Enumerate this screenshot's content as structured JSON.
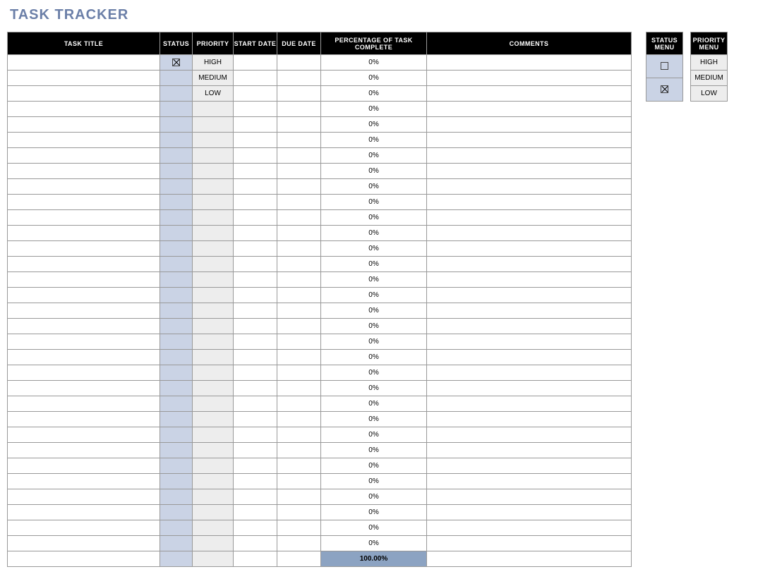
{
  "title": "TASK TRACKER",
  "headers": {
    "task_title": "TASK TITLE",
    "status": "STATUS",
    "priority": "PRIORITY",
    "start_date": "START DATE",
    "due_date": "DUE DATE",
    "pct_complete": "PERCENTAGE OF TASK COMPLETE",
    "comments": "COMMENTS"
  },
  "rows": [
    {
      "title": "",
      "status_checked": true,
      "priority": "HIGH",
      "start": "",
      "due": "",
      "pct": "0%",
      "comments": ""
    },
    {
      "title": "",
      "status_checked": false,
      "priority": "MEDIUM",
      "start": "",
      "due": "",
      "pct": "0%",
      "comments": ""
    },
    {
      "title": "",
      "status_checked": false,
      "priority": "LOW",
      "start": "",
      "due": "",
      "pct": "0%",
      "comments": ""
    },
    {
      "title": "",
      "status_checked": false,
      "priority": "",
      "start": "",
      "due": "",
      "pct": "0%",
      "comments": ""
    },
    {
      "title": "",
      "status_checked": false,
      "priority": "",
      "start": "",
      "due": "",
      "pct": "0%",
      "comments": ""
    },
    {
      "title": "",
      "status_checked": false,
      "priority": "",
      "start": "",
      "due": "",
      "pct": "0%",
      "comments": ""
    },
    {
      "title": "",
      "status_checked": false,
      "priority": "",
      "start": "",
      "due": "",
      "pct": "0%",
      "comments": ""
    },
    {
      "title": "",
      "status_checked": false,
      "priority": "",
      "start": "",
      "due": "",
      "pct": "0%",
      "comments": ""
    },
    {
      "title": "",
      "status_checked": false,
      "priority": "",
      "start": "",
      "due": "",
      "pct": "0%",
      "comments": ""
    },
    {
      "title": "",
      "status_checked": false,
      "priority": "",
      "start": "",
      "due": "",
      "pct": "0%",
      "comments": ""
    },
    {
      "title": "",
      "status_checked": false,
      "priority": "",
      "start": "",
      "due": "",
      "pct": "0%",
      "comments": ""
    },
    {
      "title": "",
      "status_checked": false,
      "priority": "",
      "start": "",
      "due": "",
      "pct": "0%",
      "comments": ""
    },
    {
      "title": "",
      "status_checked": false,
      "priority": "",
      "start": "",
      "due": "",
      "pct": "0%",
      "comments": ""
    },
    {
      "title": "",
      "status_checked": false,
      "priority": "",
      "start": "",
      "due": "",
      "pct": "0%",
      "comments": ""
    },
    {
      "title": "",
      "status_checked": false,
      "priority": "",
      "start": "",
      "due": "",
      "pct": "0%",
      "comments": ""
    },
    {
      "title": "",
      "status_checked": false,
      "priority": "",
      "start": "",
      "due": "",
      "pct": "0%",
      "comments": ""
    },
    {
      "title": "",
      "status_checked": false,
      "priority": "",
      "start": "",
      "due": "",
      "pct": "0%",
      "comments": ""
    },
    {
      "title": "",
      "status_checked": false,
      "priority": "",
      "start": "",
      "due": "",
      "pct": "0%",
      "comments": ""
    },
    {
      "title": "",
      "status_checked": false,
      "priority": "",
      "start": "",
      "due": "",
      "pct": "0%",
      "comments": ""
    },
    {
      "title": "",
      "status_checked": false,
      "priority": "",
      "start": "",
      "due": "",
      "pct": "0%",
      "comments": ""
    },
    {
      "title": "",
      "status_checked": false,
      "priority": "",
      "start": "",
      "due": "",
      "pct": "0%",
      "comments": ""
    },
    {
      "title": "",
      "status_checked": false,
      "priority": "",
      "start": "",
      "due": "",
      "pct": "0%",
      "comments": ""
    },
    {
      "title": "",
      "status_checked": false,
      "priority": "",
      "start": "",
      "due": "",
      "pct": "0%",
      "comments": ""
    },
    {
      "title": "",
      "status_checked": false,
      "priority": "",
      "start": "",
      "due": "",
      "pct": "0%",
      "comments": ""
    },
    {
      "title": "",
      "status_checked": false,
      "priority": "",
      "start": "",
      "due": "",
      "pct": "0%",
      "comments": ""
    },
    {
      "title": "",
      "status_checked": false,
      "priority": "",
      "start": "",
      "due": "",
      "pct": "0%",
      "comments": ""
    },
    {
      "title": "",
      "status_checked": false,
      "priority": "",
      "start": "",
      "due": "",
      "pct": "0%",
      "comments": ""
    },
    {
      "title": "",
      "status_checked": false,
      "priority": "",
      "start": "",
      "due": "",
      "pct": "0%",
      "comments": ""
    },
    {
      "title": "",
      "status_checked": false,
      "priority": "",
      "start": "",
      "due": "",
      "pct": "0%",
      "comments": ""
    },
    {
      "title": "",
      "status_checked": false,
      "priority": "",
      "start": "",
      "due": "",
      "pct": "0%",
      "comments": ""
    },
    {
      "title": "",
      "status_checked": false,
      "priority": "",
      "start": "",
      "due": "",
      "pct": "0%",
      "comments": ""
    },
    {
      "title": "",
      "status_checked": false,
      "priority": "",
      "start": "",
      "due": "",
      "pct": "0%",
      "comments": ""
    }
  ],
  "total_pct": "100.00%",
  "status_menu": {
    "header": "STATUS MENU",
    "items": [
      {
        "checked": false
      },
      {
        "checked": true
      }
    ]
  },
  "priority_menu": {
    "header": "PRIORITY MENU",
    "items": [
      "HIGH",
      "MEDIUM",
      "LOW"
    ]
  }
}
